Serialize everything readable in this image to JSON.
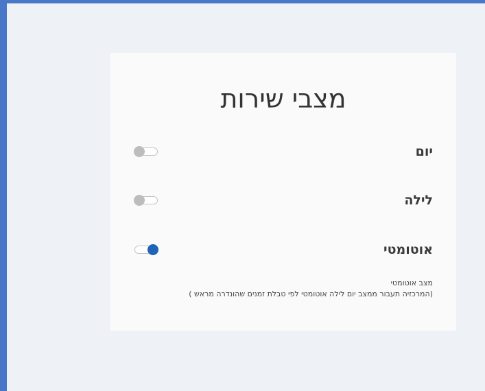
{
  "panel": {
    "title": "מצבי שירות"
  },
  "modes": [
    {
      "label": "יום",
      "enabled": false
    },
    {
      "label": "לילה",
      "enabled": false
    },
    {
      "label": "אוטומטי",
      "enabled": true
    }
  ],
  "note": {
    "line1": "מצב אוטומטי",
    "line2": "(המרכזיה תעבור ממצב יום לילה אוטומטי לפי טבלת זמנים שהונדרה מראש )"
  },
  "colors": {
    "frame": "#4a78c9",
    "background": "#eef2f6",
    "card": "#fafafa",
    "toggle_on": "#1f64b8",
    "toggle_off": "#bdbdbd"
  }
}
